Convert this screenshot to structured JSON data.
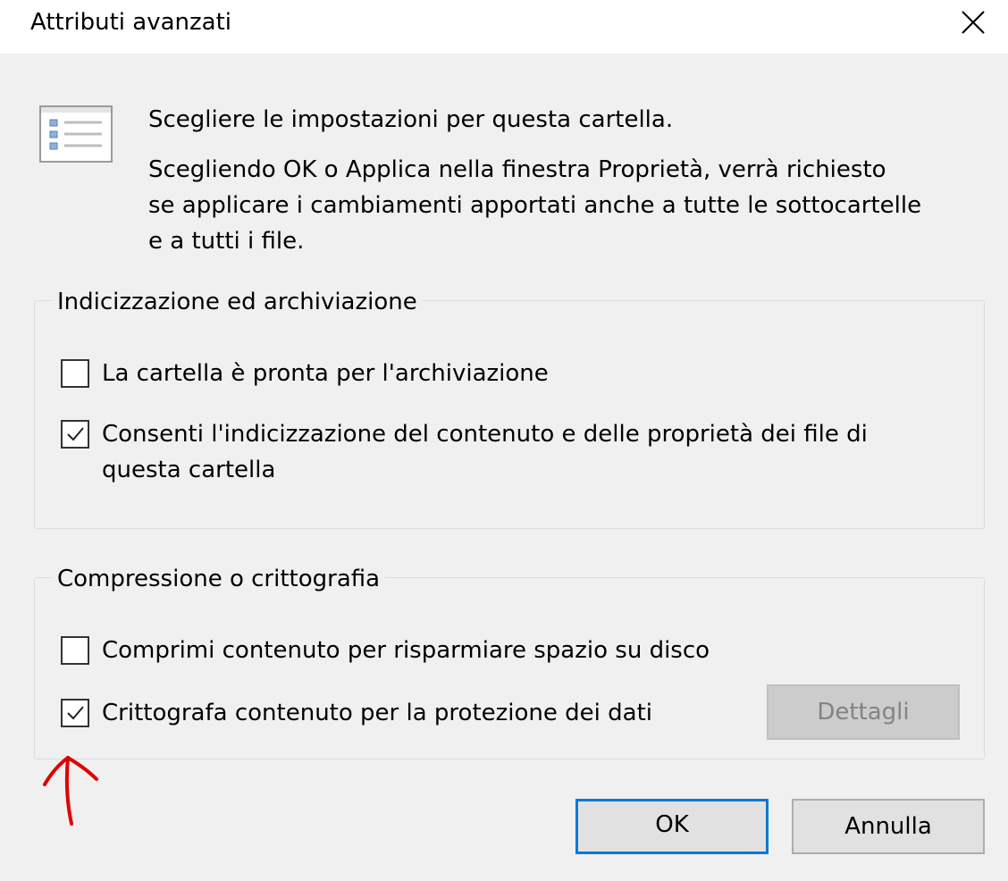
{
  "window": {
    "title": "Attributi avanzati",
    "close_icon": "close-icon"
  },
  "intro": {
    "icon": "checklist-icon",
    "line1": "Scegliere le impostazioni per questa cartella.",
    "line2": "Scegliendo OK o Applica nella finestra Proprietà, verrà richiesto",
    "line3": "se applicare i cambiamenti apportati anche a tutte le sottocartelle",
    "line4": "e a tutti i file."
  },
  "indexing_group": {
    "title": "Indicizzazione ed archiviazione",
    "archive": {
      "label": "La cartella è pronta per l'archiviazione",
      "checked": false
    },
    "index": {
      "label_line1": "Consenti l'indicizzazione del contenuto e delle proprietà dei file di",
      "label_line2": "questa cartella",
      "checked": true
    }
  },
  "compression_group": {
    "title": "Compressione o crittografia",
    "compress": {
      "label": "Comprimi contenuto per risparmiare spazio su disco",
      "checked": false
    },
    "encrypt": {
      "label": "Crittografa contenuto per la protezione dei dati",
      "checked": true
    },
    "details_label": "Dettagli"
  },
  "buttons": {
    "ok_label": "OK",
    "cancel_label": "Annulla"
  },
  "annotation": {
    "icon": "red-arrow-annotation",
    "color": "#e00000"
  },
  "colors": {
    "accent": "#0078d7",
    "dialog_bg": "#f0f0f0"
  }
}
